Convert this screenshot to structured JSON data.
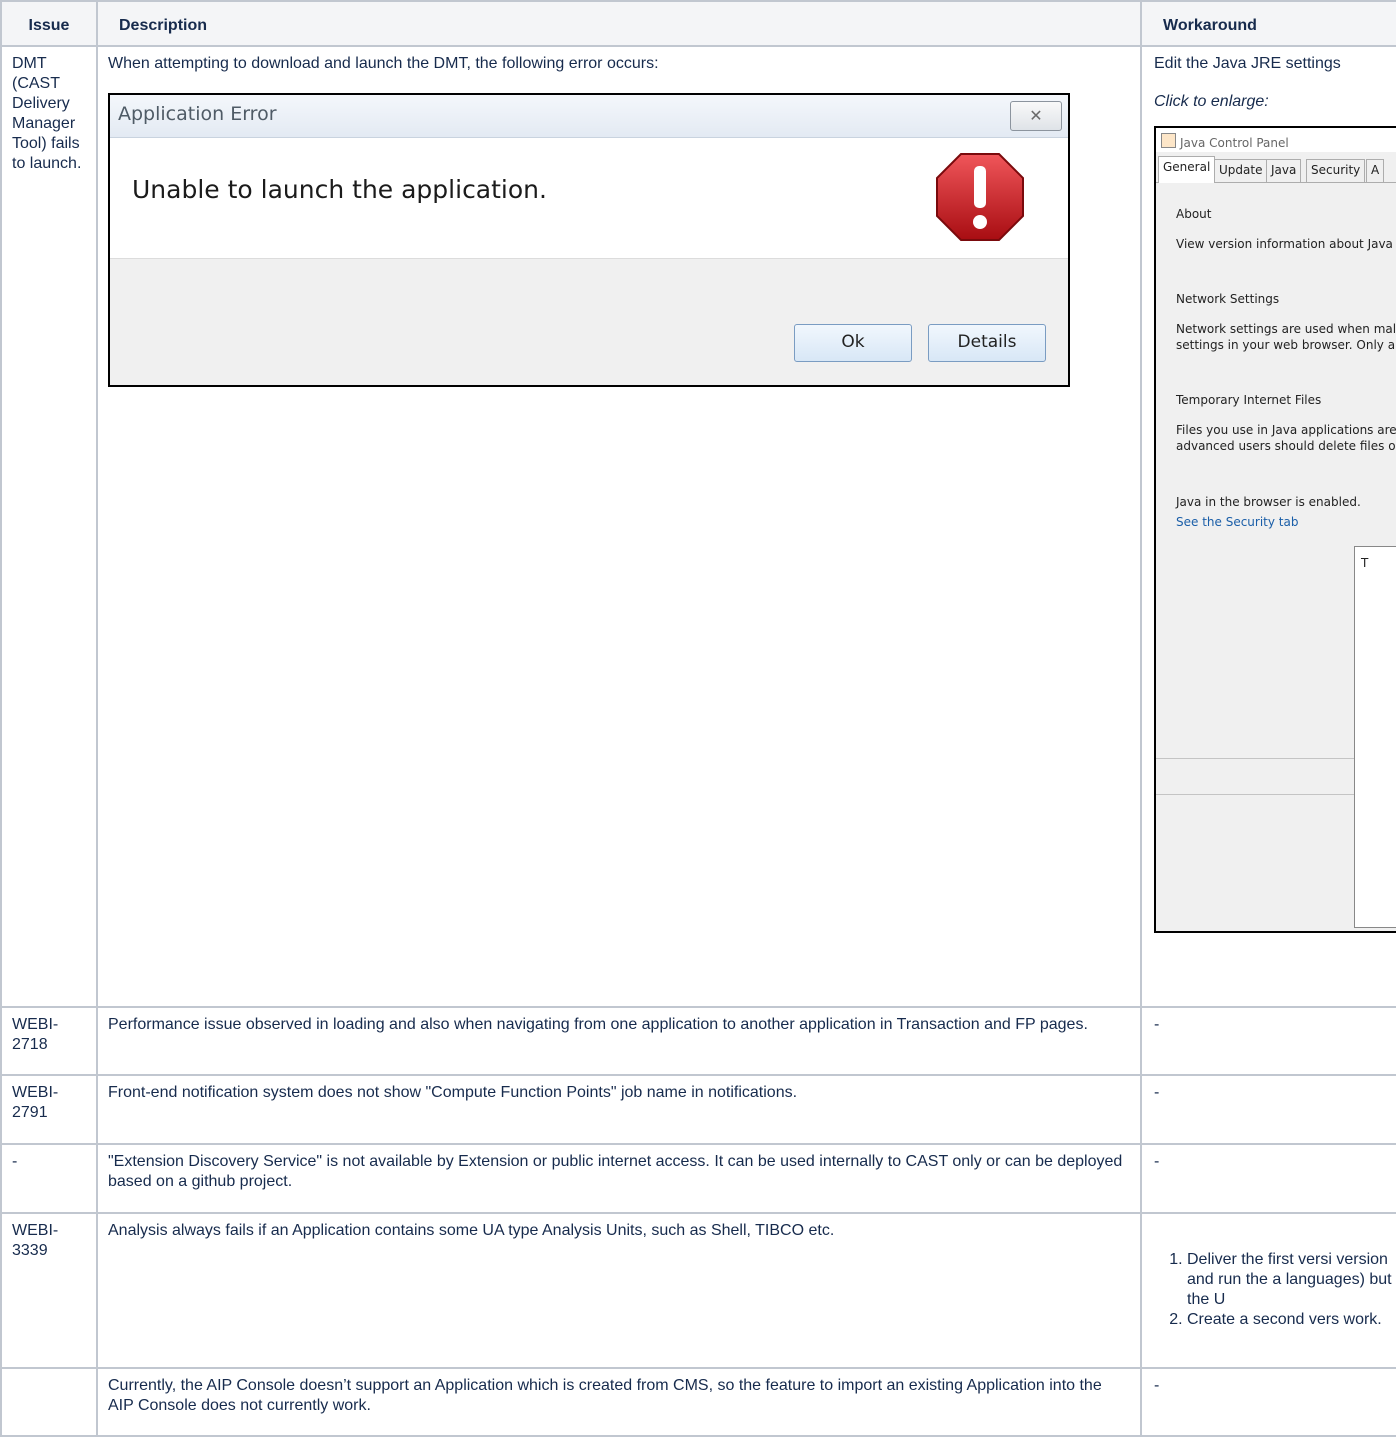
{
  "headers": {
    "issue": "Issue",
    "description": "Description",
    "workaround": "Workaround"
  },
  "rows": [
    {
      "issue": "DMT (CAST Delivery Manager Tool) fails to launch.",
      "description": "When attempting to download and launch the DMT, the following error occurs:",
      "workaround": "Edit the Java JRE settings",
      "click_note": "Click to enlarge:"
    },
    {
      "issue": "WEBI-2718",
      "description": "Performance issue observed in loading and also when navigating from one application to another application in Transaction and FP pages.",
      "workaround": "-"
    },
    {
      "issue": "WEBI-2791",
      "description": "Front-end notification system does not show \"Compute Function Points\" job name in notifications.",
      "workaround": "-"
    },
    {
      "issue": "-",
      "description": "\"Extension Discovery Service\" is not available by Extension or public internet access. It can be used internally to CAST only or can be deployed based on a github project.",
      "workaround": "-"
    },
    {
      "issue": "WEBI-3339",
      "description": "Analysis always fails if an Application contains some UA type Analysis Units, such as Shell, TIBCO etc.",
      "workaround_steps": [
        "Deliver the first versi version and run the a languages) but the U",
        "Create a second vers work."
      ]
    },
    {
      "issue": "",
      "description": "Currently, the AIP Console doesn’t support an Application which is created from CMS, so the feature to import an existing Application into the AIP Console does not currently work.",
      "workaround": "-"
    }
  ],
  "app_error_dialog": {
    "title": "Application Error",
    "close_glyph": "✕",
    "message": "Unable to launch the application.",
    "ok_label": "Ok",
    "details_label": "Details",
    "icon": "stop-error-icon"
  },
  "java_control_panel": {
    "title": "Java Control Panel",
    "tabs": [
      "General",
      "Update",
      "Java",
      "Security",
      "A"
    ],
    "about_heading": "About",
    "about_text": "View version information about Java",
    "network_heading": "Network Settings",
    "network_text_1": "Network settings are used when mal",
    "network_text_2": "settings in your web browser. Only a",
    "temp_heading": "Temporary Internet Files",
    "temp_text_1": "Files you use in Java applications are",
    "temp_text_2": "advanced users should delete files o",
    "browser_text": "Java in the browser is enabled.",
    "security_link": "See the Security tab",
    "sub_dialog_text": "T"
  }
}
